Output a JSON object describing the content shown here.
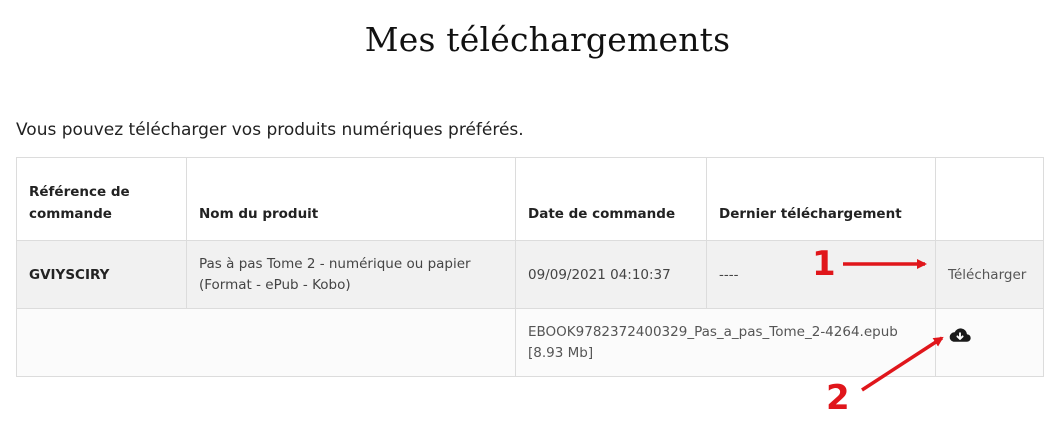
{
  "page": {
    "title": "Mes téléchargements",
    "intro": "Vous pouvez télécharger vos produits numériques préférés."
  },
  "table": {
    "headers": {
      "reference": "Référence de commande",
      "product": "Nom du produit",
      "order_date": "Date de commande",
      "last_download": "Dernier téléchargement",
      "action": ""
    },
    "order": {
      "reference": "GVIYSCIRY",
      "product": "Pas à pas Tome 2 - numérique ou papier (Format - ePub - Kobo)",
      "order_date": "09/09/2021 04:10:37",
      "last_download": "----",
      "download_label": "Télécharger"
    },
    "file": {
      "filename": "EBOOK9782372400329_Pas_a_pas_Tome_2-4264.epub",
      "size": "[8.93 Mb]"
    }
  },
  "annotations": {
    "marker_1": "1",
    "marker_2": "2",
    "color": "#e0161b"
  },
  "icons": {
    "file_download": "cloud-download-icon"
  }
}
